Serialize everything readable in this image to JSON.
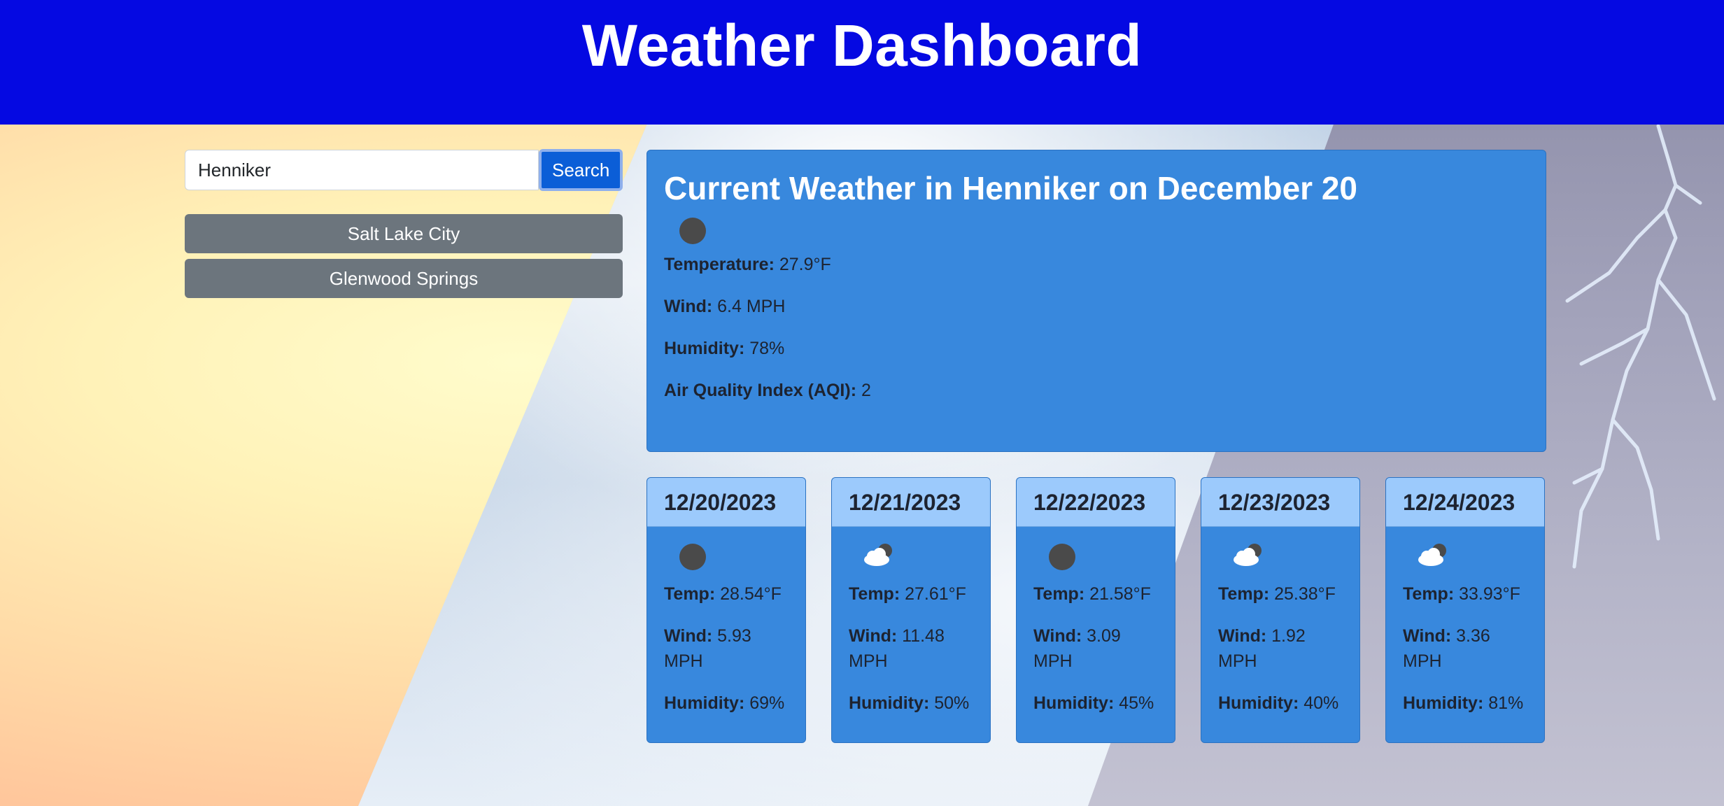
{
  "header": {
    "title": "Weather Dashboard"
  },
  "search": {
    "value": "Henniker",
    "button_label": "Search"
  },
  "history": [
    {
      "label": "Salt Lake City"
    },
    {
      "label": "Glenwood Springs"
    }
  ],
  "current": {
    "title": "Current Weather in Henniker on December 20",
    "icon": "night-clear-icon",
    "temperature_label": "Temperature:",
    "temperature": "27.9°F",
    "wind_label": "Wind:",
    "wind": "6.4 MPH",
    "humidity_label": "Humidity:",
    "humidity": "78%",
    "aqi_label": "Air Quality Index (AQI):",
    "aqi": "2"
  },
  "forecast": [
    {
      "date": "12/20/2023",
      "icon": "night-clear-icon",
      "temp_label": "Temp:",
      "temp": "28.54°F",
      "wind_label": "Wind:",
      "wind": "5.93 MPH",
      "humidity_label": "Humidity:",
      "humidity": "69%"
    },
    {
      "date": "12/21/2023",
      "icon": "night-clouds-icon",
      "temp_label": "Temp:",
      "temp": "27.61°F",
      "wind_label": "Wind:",
      "wind": "11.48 MPH",
      "humidity_label": "Humidity:",
      "humidity": "50%"
    },
    {
      "date": "12/22/2023",
      "icon": "night-clear-icon",
      "temp_label": "Temp:",
      "temp": "21.58°F",
      "wind_label": "Wind:",
      "wind": "3.09 MPH",
      "humidity_label": "Humidity:",
      "humidity": "45%"
    },
    {
      "date": "12/23/2023",
      "icon": "night-clouds-icon",
      "temp_label": "Temp:",
      "temp": "25.38°F",
      "wind_label": "Wind:",
      "wind": "1.92 MPH",
      "humidity_label": "Humidity:",
      "humidity": "40%"
    },
    {
      "date": "12/24/2023",
      "icon": "night-clouds-icon",
      "temp_label": "Temp:",
      "temp": "33.93°F",
      "wind_label": "Wind:",
      "wind": "3.36 MPH",
      "humidity_label": "Humidity:",
      "humidity": "81%"
    }
  ],
  "colors": {
    "header": "#0509e2",
    "card": "#3888dd",
    "card_header": "#9ccafc",
    "search_button": "#0b5ed7",
    "history_button": "#6c757d"
  }
}
